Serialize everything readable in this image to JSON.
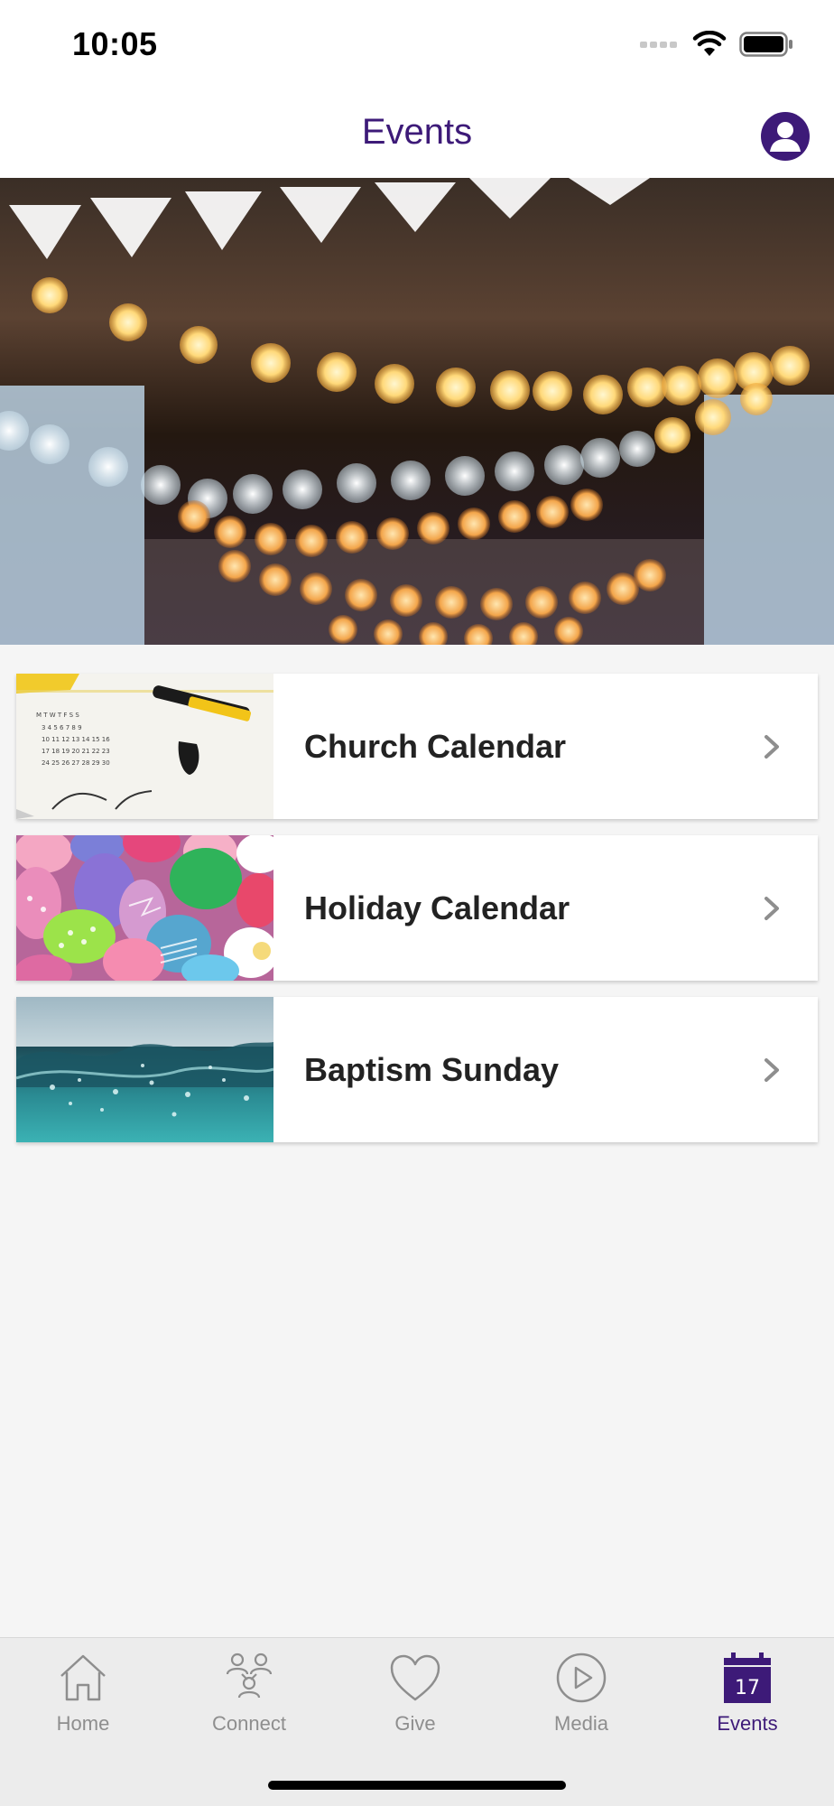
{
  "status_bar": {
    "time": "10:05"
  },
  "nav": {
    "title": "Events"
  },
  "events": [
    {
      "label": "Church Calendar"
    },
    {
      "label": "Holiday Calendar"
    },
    {
      "label": "Baptism Sunday"
    }
  ],
  "tabs": [
    {
      "label": "Home",
      "icon": "home-icon",
      "active": false
    },
    {
      "label": "Connect",
      "icon": "people-icon",
      "active": false
    },
    {
      "label": "Give",
      "icon": "heart-icon",
      "active": false
    },
    {
      "label": "Media",
      "icon": "play-icon",
      "active": false
    },
    {
      "label": "Events",
      "icon": "calendar-icon",
      "active": true,
      "calendar_day": "17"
    }
  ],
  "colors": {
    "accent": "#3d1a78",
    "inactive": "#8e8e8e",
    "tab_bar_bg": "#ececec",
    "page_bg": "#f5f5f5"
  }
}
